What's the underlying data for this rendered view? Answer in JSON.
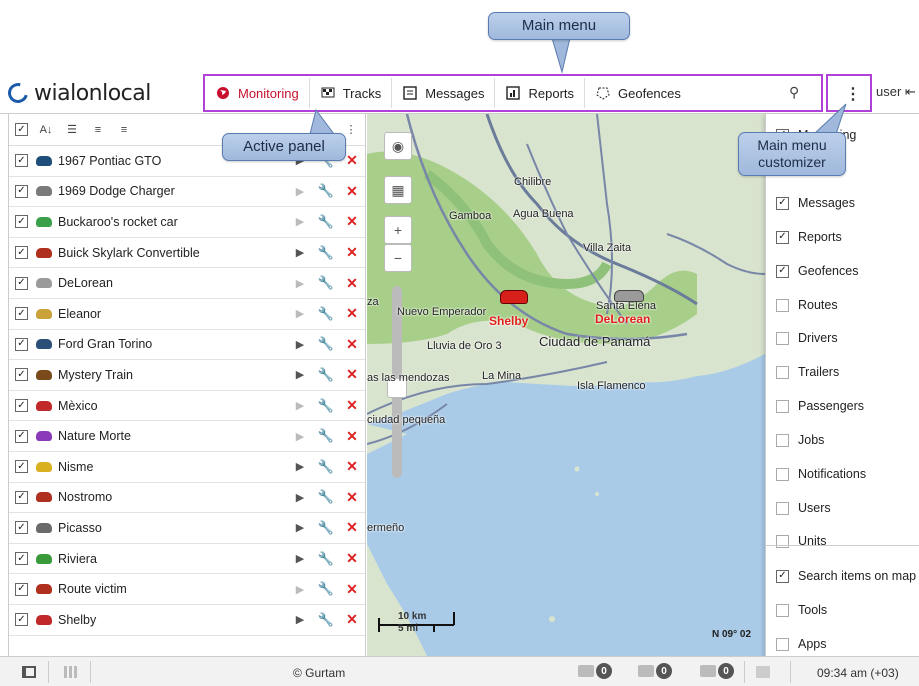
{
  "callouts": {
    "main_menu": "Main menu",
    "active_panel": "Active panel",
    "customizer": "Main menu customizer"
  },
  "header": {
    "logo": "wialonlocal",
    "menu": [
      {
        "label": "Monitoring",
        "icon": "globe-icon",
        "active": true
      },
      {
        "label": "Tracks",
        "icon": "flag-icon",
        "active": false
      },
      {
        "label": "Messages",
        "icon": "messages-icon",
        "active": false
      },
      {
        "label": "Reports",
        "icon": "reports-icon",
        "active": false
      },
      {
        "label": "Geofences",
        "icon": "geofence-icon",
        "active": false
      }
    ],
    "user": "user"
  },
  "units": [
    {
      "name": "1967 Pontiac GTO",
      "color": "#1f4e7a",
      "play": true
    },
    {
      "name": "1969 Dodge Charger",
      "color": "#7a7a7a",
      "play": false
    },
    {
      "name": "Buckaroo's rocket car",
      "color": "#3aa14a",
      "play": false
    },
    {
      "name": "Buick Skylark Convertible",
      "color": "#b03020",
      "play": true
    },
    {
      "name": "DeLorean",
      "color": "#9a9a9a",
      "play": false
    },
    {
      "name": "Eleanor",
      "color": "#c9a23a",
      "play": false
    },
    {
      "name": "Ford Gran Torino",
      "color": "#2c4f78",
      "play": true
    },
    {
      "name": "Mystery Train",
      "color": "#7a4a1a",
      "play": true
    },
    {
      "name": "Mèxico",
      "color": "#c0282a",
      "play": false
    },
    {
      "name": "Nature Morte",
      "color": "#8a3ab8",
      "play": false
    },
    {
      "name": "Nisme",
      "color": "#d8b020",
      "play": true
    },
    {
      "name": "Nostromo",
      "color": "#b03020",
      "play": true
    },
    {
      "name": "Picasso",
      "color": "#6a6a6a",
      "play": true
    },
    {
      "name": "Riviera",
      "color": "#3a9a3a",
      "play": true
    },
    {
      "name": "Route victim",
      "color": "#b03020",
      "play": false
    },
    {
      "name": "Shelby",
      "color": "#c0282a",
      "play": true
    }
  ],
  "map": {
    "places": [
      "Chilibre",
      "Gamboa",
      "Agua Buena",
      "Villa Zaita",
      "Nuevo Emperador",
      "Santa Elena",
      "Lluvia de Oro 3",
      "Ciudad de Panamá",
      "La Mina",
      "Isla Flamenco",
      "ciudad pequeña",
      "as las mendozas",
      "za",
      "ermeño"
    ],
    "unit_labels": [
      "Shelby",
      "DeLorean"
    ],
    "scale_km": "10 km",
    "scale_mi": "5 mi",
    "coords": "N 09° 02"
  },
  "customizer": [
    {
      "label": "Monitoring",
      "checked": true
    },
    {
      "label": "Messages",
      "checked": true
    },
    {
      "label": "Reports",
      "checked": true
    },
    {
      "label": "Geofences",
      "checked": true
    },
    {
      "label": "Routes",
      "checked": false
    },
    {
      "label": "Drivers",
      "checked": false
    },
    {
      "label": "Trailers",
      "checked": false
    },
    {
      "label": "Passengers",
      "checked": false
    },
    {
      "label": "Jobs",
      "checked": false
    },
    {
      "label": "Notifications",
      "checked": false
    },
    {
      "label": "Users",
      "checked": false
    },
    {
      "label": "Units",
      "checked": false
    },
    {
      "label": "Search items on map",
      "checked": true
    },
    {
      "label": "Tools",
      "checked": false
    },
    {
      "label": "Apps",
      "checked": false
    }
  ],
  "footer": {
    "copyright": "© Gurtam",
    "counts": [
      "0",
      "0",
      "0"
    ],
    "time": "09:34 am (+03)"
  }
}
